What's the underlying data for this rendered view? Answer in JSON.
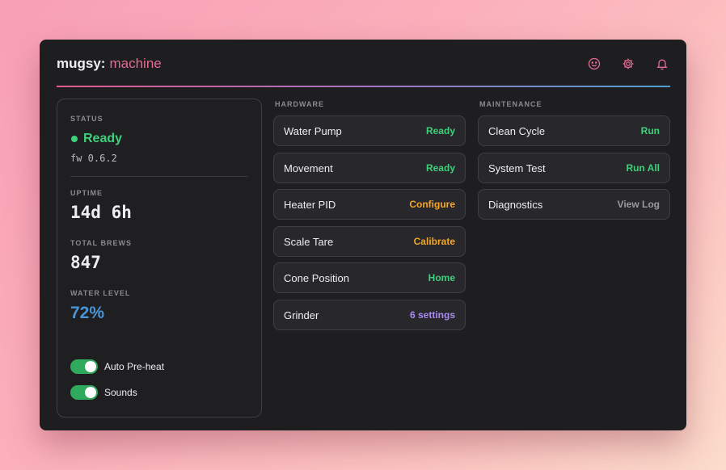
{
  "header": {
    "brand_main": "mugsy:",
    "brand_sub": "machine",
    "icons": [
      "smile-icon",
      "gear-icon",
      "bell-icon"
    ]
  },
  "status": {
    "status_label": "STATUS",
    "state": "Ready",
    "firmware": "fw 0.6.2",
    "uptime_label": "UPTIME",
    "uptime": "14d 6h",
    "brews_label": "TOTAL BREWS",
    "brews": "847",
    "water_label": "WATER LEVEL",
    "water": "72%",
    "toggles": [
      {
        "label": "Auto Pre-heat",
        "on": true
      },
      {
        "label": "Sounds",
        "on": true
      }
    ]
  },
  "hardware": {
    "title": "HARDWARE",
    "items": [
      {
        "name": "Water Pump",
        "action": "Ready",
        "color": "#3ed07a"
      },
      {
        "name": "Movement",
        "action": "Ready",
        "color": "#3ed07a"
      },
      {
        "name": "Heater PID",
        "action": "Configure",
        "color": "#f5a623"
      },
      {
        "name": "Scale Tare",
        "action": "Calibrate",
        "color": "#f5a623"
      },
      {
        "name": "Cone Position",
        "action": "Home",
        "color": "#3ed07a"
      },
      {
        "name": "Grinder",
        "action": "6 settings",
        "color": "#a98bf0"
      }
    ]
  },
  "maintenance": {
    "title": "MAINTENANCE",
    "items": [
      {
        "name": "Clean Cycle",
        "action": "Run",
        "color": "#3ed07a"
      },
      {
        "name": "System Test",
        "action": "Run All",
        "color": "#3ed07a"
      },
      {
        "name": "Diagnostics",
        "action": "View Log",
        "color": "#9a9aa0"
      }
    ]
  },
  "colors": {
    "accent": "#e56b93",
    "ready_green": "#3ed07a",
    "warn_orange": "#f5a623",
    "water_blue": "#4a95d8"
  }
}
